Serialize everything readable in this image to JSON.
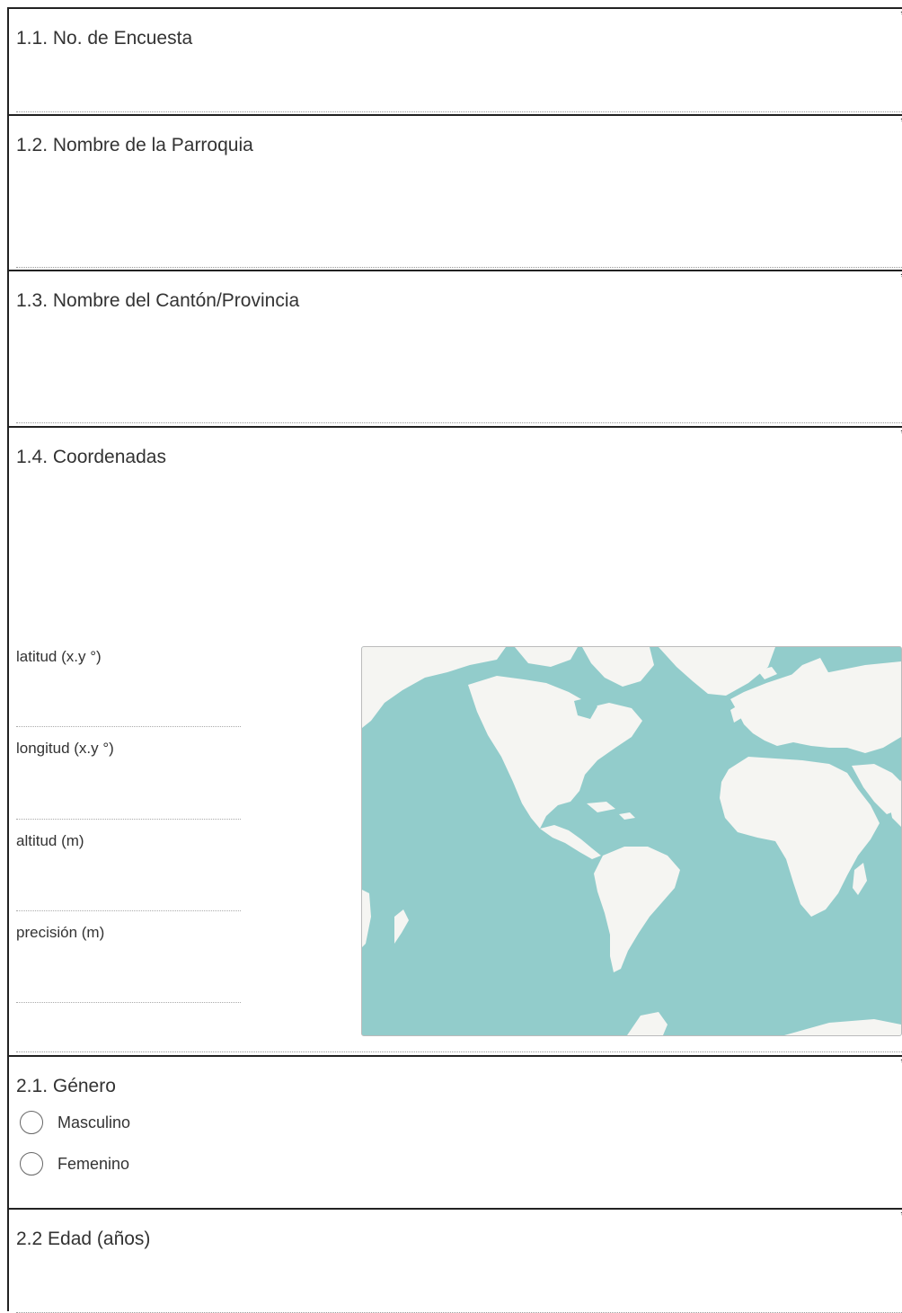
{
  "form": {
    "required_mark": "*",
    "q1_1": {
      "label": "1.1. No. de Encuesta",
      "value": ""
    },
    "q1_2": {
      "label": "1.2. Nombre de la Parroquia",
      "value": ""
    },
    "q1_3": {
      "label": "1.3. Nombre del Cantón/Provincia",
      "value": ""
    },
    "q1_4": {
      "label": "1.4. Coordenadas",
      "lat_label": "latitud (x.y °)",
      "lng_label": "longitud (x.y °)",
      "alt_label": "altitud (m)",
      "prec_label": "precisión (m)",
      "map": {
        "water_color": "#92cccb",
        "land_color": "#f5f5f2"
      }
    },
    "q2_1": {
      "label": "2.1. Género",
      "options": [
        "Masculino",
        "Femenino"
      ]
    },
    "q2_2": {
      "label": "2.2 Edad (años)",
      "value": ""
    }
  }
}
